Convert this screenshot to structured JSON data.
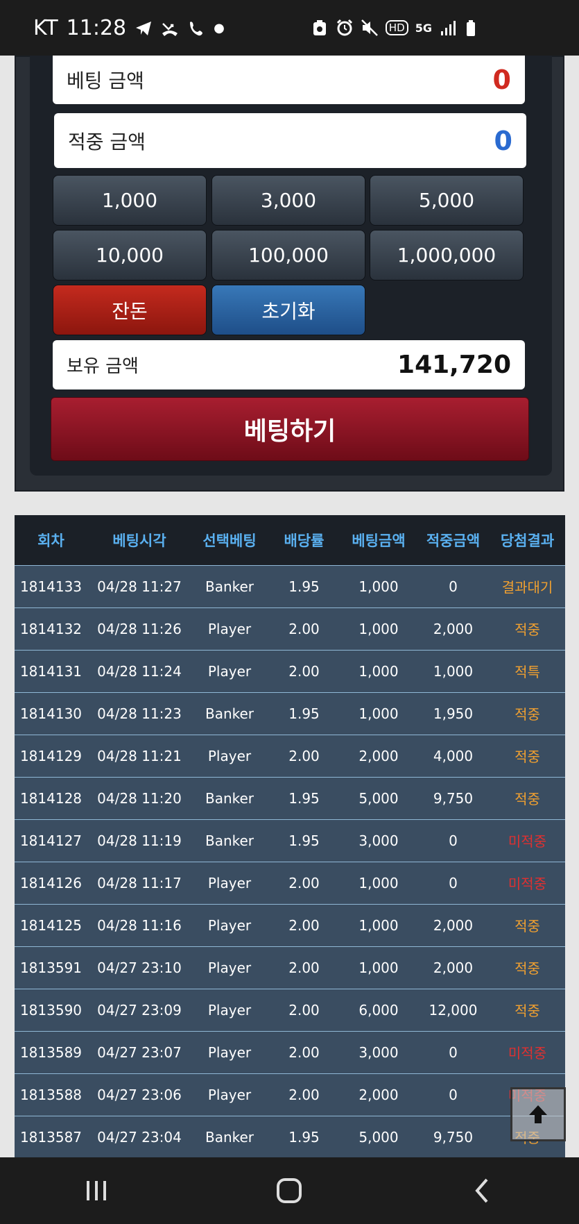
{
  "status_bar": {
    "carrier": "KT",
    "time": "11:28",
    "network": "5G"
  },
  "bet_form": {
    "bet_amount_label": "베팅 금액",
    "bet_amount_value": "0",
    "win_amount_label": "적중 금액",
    "win_amount_value": "0",
    "chips": [
      "1,000",
      "3,000",
      "5,000",
      "10,000",
      "100,000",
      "1,000,000"
    ],
    "change_label": "잔돈",
    "reset_label": "초기화",
    "balance_label": "보유 금액",
    "balance_value": "141,720",
    "submit_label": "베팅하기"
  },
  "history": {
    "headers": [
      "회차",
      "베팅시각",
      "선택베팅",
      "배당률",
      "베팅금액",
      "적중금액",
      "당첨결과"
    ],
    "rows": [
      [
        "1814133",
        "04/28 11:27",
        "Banker",
        "1.95",
        "1,000",
        "0",
        "결과대기"
      ],
      [
        "1814132",
        "04/28 11:26",
        "Player",
        "2.00",
        "1,000",
        "2,000",
        "적중"
      ],
      [
        "1814131",
        "04/28 11:24",
        "Player",
        "2.00",
        "1,000",
        "1,000",
        "적특"
      ],
      [
        "1814130",
        "04/28 11:23",
        "Banker",
        "1.95",
        "1,000",
        "1,950",
        "적중"
      ],
      [
        "1814129",
        "04/28 11:21",
        "Player",
        "2.00",
        "2,000",
        "4,000",
        "적중"
      ],
      [
        "1814128",
        "04/28 11:20",
        "Banker",
        "1.95",
        "5,000",
        "9,750",
        "적중"
      ],
      [
        "1814127",
        "04/28 11:19",
        "Banker",
        "1.95",
        "3,000",
        "0",
        "미적중"
      ],
      [
        "1814126",
        "04/28 11:17",
        "Player",
        "2.00",
        "1,000",
        "0",
        "미적중"
      ],
      [
        "1814125",
        "04/28 11:16",
        "Player",
        "2.00",
        "1,000",
        "2,000",
        "적중"
      ],
      [
        "1813591",
        "04/27 23:10",
        "Player",
        "2.00",
        "1,000",
        "2,000",
        "적중"
      ],
      [
        "1813590",
        "04/27 23:09",
        "Player",
        "2.00",
        "6,000",
        "12,000",
        "적중"
      ],
      [
        "1813589",
        "04/27 23:07",
        "Player",
        "2.00",
        "3,000",
        "0",
        "미적중"
      ],
      [
        "1813588",
        "04/27 23:06",
        "Player",
        "2.00",
        "2,000",
        "0",
        "미적중"
      ],
      [
        "1813587",
        "04/27 23:04",
        "Banker",
        "1.95",
        "5,000",
        "9,750",
        "적중"
      ]
    ]
  },
  "colors": {
    "result_hit": "#f0a030",
    "result_miss": "#e03030",
    "header_text": "#5ab0f0",
    "row_bg": "#3a4d61"
  }
}
